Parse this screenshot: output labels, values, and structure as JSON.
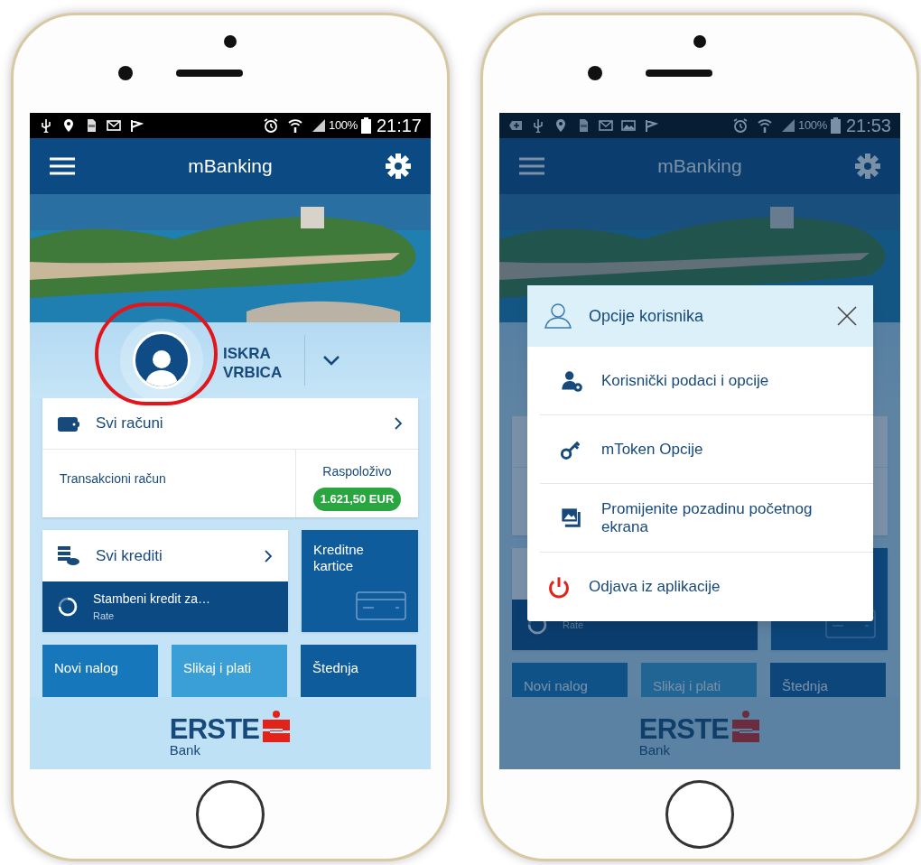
{
  "phones": [
    {
      "status_bar": {
        "battery": "100%",
        "time": "21:17"
      },
      "app_bar": {
        "title": "mBanking"
      },
      "profile": {
        "name_lines": [
          "ISKRA",
          "VRBICA"
        ],
        "highlighted": true
      },
      "accounts": {
        "title": "Svi računi",
        "account": "Transakcioni račun",
        "available_label": "Raspoloživo",
        "balance": "1.621,50 EUR"
      },
      "credits": {
        "title": "Svi krediti",
        "loan": "Stambeni kredit za…",
        "loan_sub": "Rate"
      },
      "cards_tile": "Kreditne kartice",
      "tiles": [
        {
          "label": "Novi nalog",
          "kind": "mid"
        },
        {
          "label": "Slikaj i plati",
          "kind": "light"
        },
        {
          "label": "Štednja",
          "kind": "dark"
        }
      ],
      "logo": {
        "name": "ERSTE",
        "sub": "Bank"
      }
    },
    {
      "status_bar": {
        "plus_notification": true,
        "image_notification": true,
        "battery": "100%",
        "time": "21:53"
      },
      "app_bar": {
        "title": "mBanking"
      },
      "credits": {
        "loan_sub": "Rate"
      },
      "tiles": [
        {
          "label": "Novi nalog",
          "kind": "mid"
        },
        {
          "label": "Slikaj i plati",
          "kind": "light"
        },
        {
          "label": "Štednja",
          "kind": "dark"
        }
      ],
      "logo": {
        "name": "ERSTE",
        "sub": "Bank"
      },
      "dialog": {
        "title": "Opcije korisnika",
        "items": [
          {
            "label": "Korisnički podaci i opcije",
            "kind": "user-settings"
          },
          {
            "label": "mToken Opcije",
            "kind": "key"
          },
          {
            "label": "Promijenite pozadinu početnog ekrana",
            "kind": "wallpaper"
          },
          {
            "label": "Odjava iz aplikacije",
            "kind": "logout"
          }
        ]
      }
    }
  ]
}
